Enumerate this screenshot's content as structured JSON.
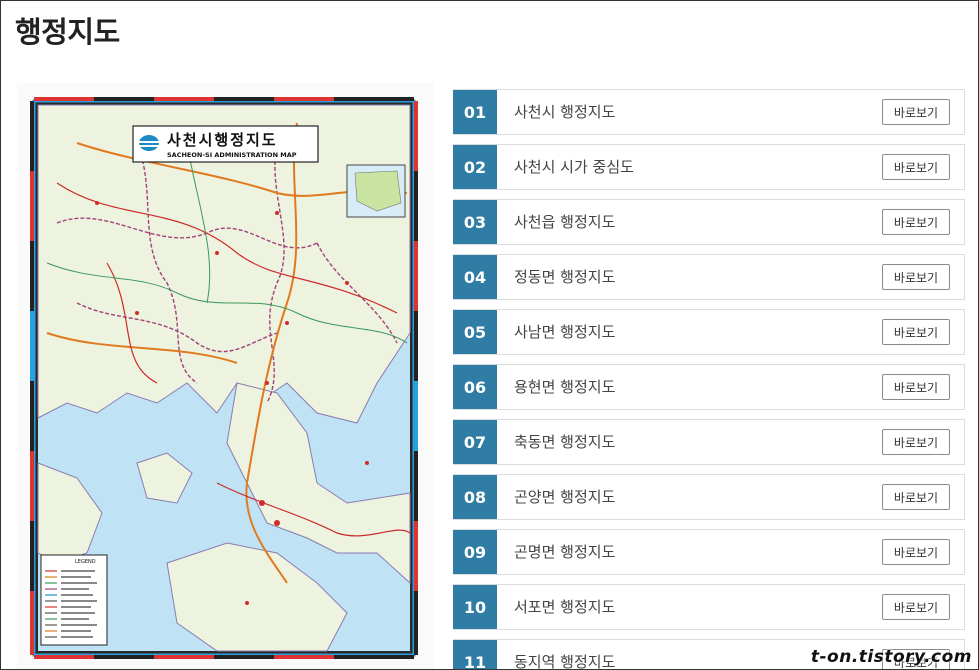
{
  "page": {
    "title": "행정지도"
  },
  "map": {
    "title": "사천시행정지도",
    "subtitle": "SACHEON-SI ADMINISTRATION MAP",
    "legend_title": "LEGEND"
  },
  "list": {
    "button_label": "바로보기",
    "items": [
      {
        "num": "01",
        "label": "사천시 행정지도"
      },
      {
        "num": "02",
        "label": "사천시 시가 중심도"
      },
      {
        "num": "03",
        "label": "사천읍 행정지도"
      },
      {
        "num": "04",
        "label": "정동면 행정지도"
      },
      {
        "num": "05",
        "label": "사남면 행정지도"
      },
      {
        "num": "06",
        "label": "용현면 행정지도"
      },
      {
        "num": "07",
        "label": "축동면 행정지도"
      },
      {
        "num": "08",
        "label": "곤양면 행정지도"
      },
      {
        "num": "09",
        "label": "곤명면 행정지도"
      },
      {
        "num": "10",
        "label": "서포면 행정지도"
      },
      {
        "num": "11",
        "label": "동지역 행정지도"
      }
    ]
  },
  "watermark": "t-on.tistory.com",
  "colors": {
    "number_badge": "#2f7ca4",
    "sea": "#bfe3f5",
    "land": "#eef3df"
  }
}
